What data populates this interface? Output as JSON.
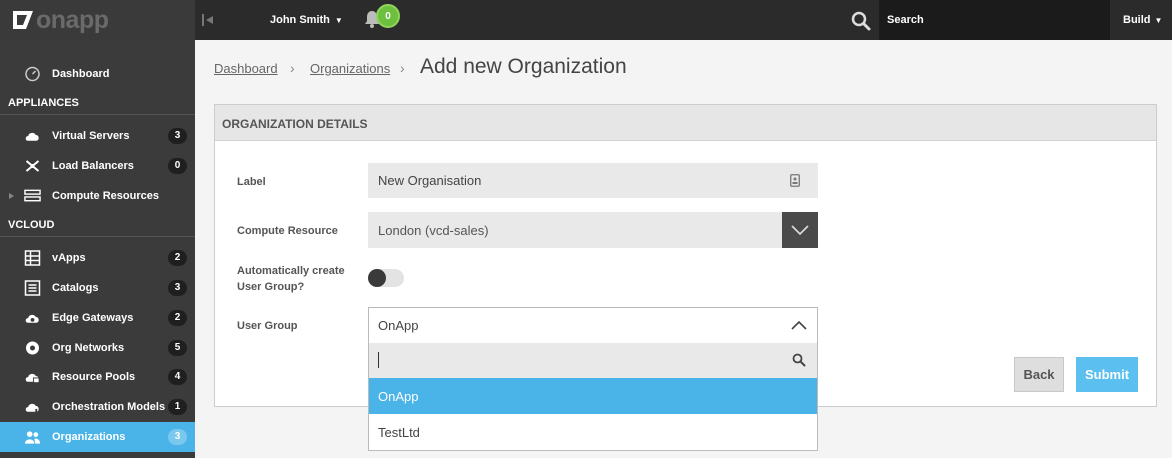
{
  "brand": {
    "logo_text": "onapp",
    "accent": "#4ab4e8",
    "submit_color": "#5bc0f0"
  },
  "topbar": {
    "user_name": "John Smith",
    "notifications_count": "0",
    "search_placeholder": "Search",
    "build_label": "Build",
    "icons": [
      "collapse-sidebar-icon",
      "chevron-down-icon",
      "bell-icon",
      "search-icon"
    ]
  },
  "sidebar": {
    "dashboard": {
      "label": "Dashboard",
      "icon": "dashboard-icon"
    },
    "sections": {
      "appliances": "APPLIANCES",
      "vcloud": "VCLOUD"
    },
    "appliances": [
      {
        "label": "Virtual Servers",
        "count": "3",
        "icon": "cloud-icon"
      },
      {
        "label": "Load Balancers",
        "count": "0",
        "icon": "load-balancer-icon"
      },
      {
        "label": "Compute Resources",
        "icon": "server-icon"
      }
    ],
    "vcloud": [
      {
        "label": "vApps",
        "count": "2",
        "icon": "grid-icon"
      },
      {
        "label": "Catalogs",
        "count": "3",
        "icon": "catalog-icon"
      },
      {
        "label": "Edge Gateways",
        "count": "2",
        "icon": "gateway-icon"
      },
      {
        "label": "Org Networks",
        "count": "5",
        "icon": "network-icon"
      },
      {
        "label": "Resource Pools",
        "count": "4",
        "icon": "cloud-pool-icon"
      },
      {
        "label": "Orchestration Models",
        "count": "1",
        "icon": "orchestration-icon"
      },
      {
        "label": "Organizations",
        "count": "3",
        "icon": "users-icon",
        "active": true
      }
    ]
  },
  "breadcrumb": {
    "items": [
      "Dashboard",
      "Organizations"
    ],
    "current": "Add new Organization"
  },
  "panel": {
    "header": "ORGANIZATION DETAILS",
    "label_field": {
      "label": "Label",
      "value": "New Organisation"
    },
    "compute_resource": {
      "label": "Compute Resource",
      "value": "London (vcd-sales)"
    },
    "auto_create": {
      "label_line1": "Automatically create",
      "label_line2": "User Group?",
      "enabled": false
    },
    "user_group": {
      "label": "User Group",
      "selected": "OnApp",
      "search_value": "",
      "options": [
        "OnApp",
        "TestLtd"
      ],
      "highlighted": "OnApp"
    },
    "buttons": {
      "back": "Back",
      "submit": "Submit"
    }
  }
}
